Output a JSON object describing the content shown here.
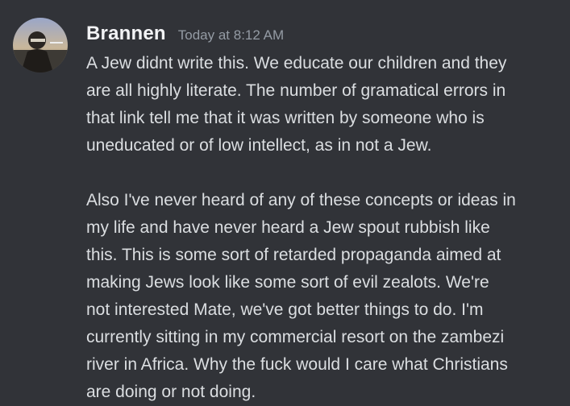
{
  "author": {
    "username": "Brannen",
    "timestamp": "Today at 8:12 AM"
  },
  "message": {
    "paragraph1": [
      "A Jew didnt write this. We educate our children and they",
      "are all highly literate. The number of gramatical errors in",
      "that link tell me that it was written by someone who is",
      "uneducated or of low intellect, as in not a Jew."
    ],
    "paragraph2": [
      "Also I've never heard of any of these concepts or ideas in",
      "my life and have never heard a Jew spout rubbish like",
      "this. This is some sort of retarded propaganda aimed at",
      "making Jews look like some sort of evil zealots. We're",
      "not interested Mate, we've got better things to do. I'm",
      "currently sitting in my commercial resort on the zambezi",
      "river in Africa. Why the fuck would I care what Christians",
      "are doing or not doing."
    ]
  },
  "colors": {
    "background": "#313338",
    "username": "#f2f3f5",
    "timestamp": "#949ba4",
    "text": "#dbdee1"
  }
}
